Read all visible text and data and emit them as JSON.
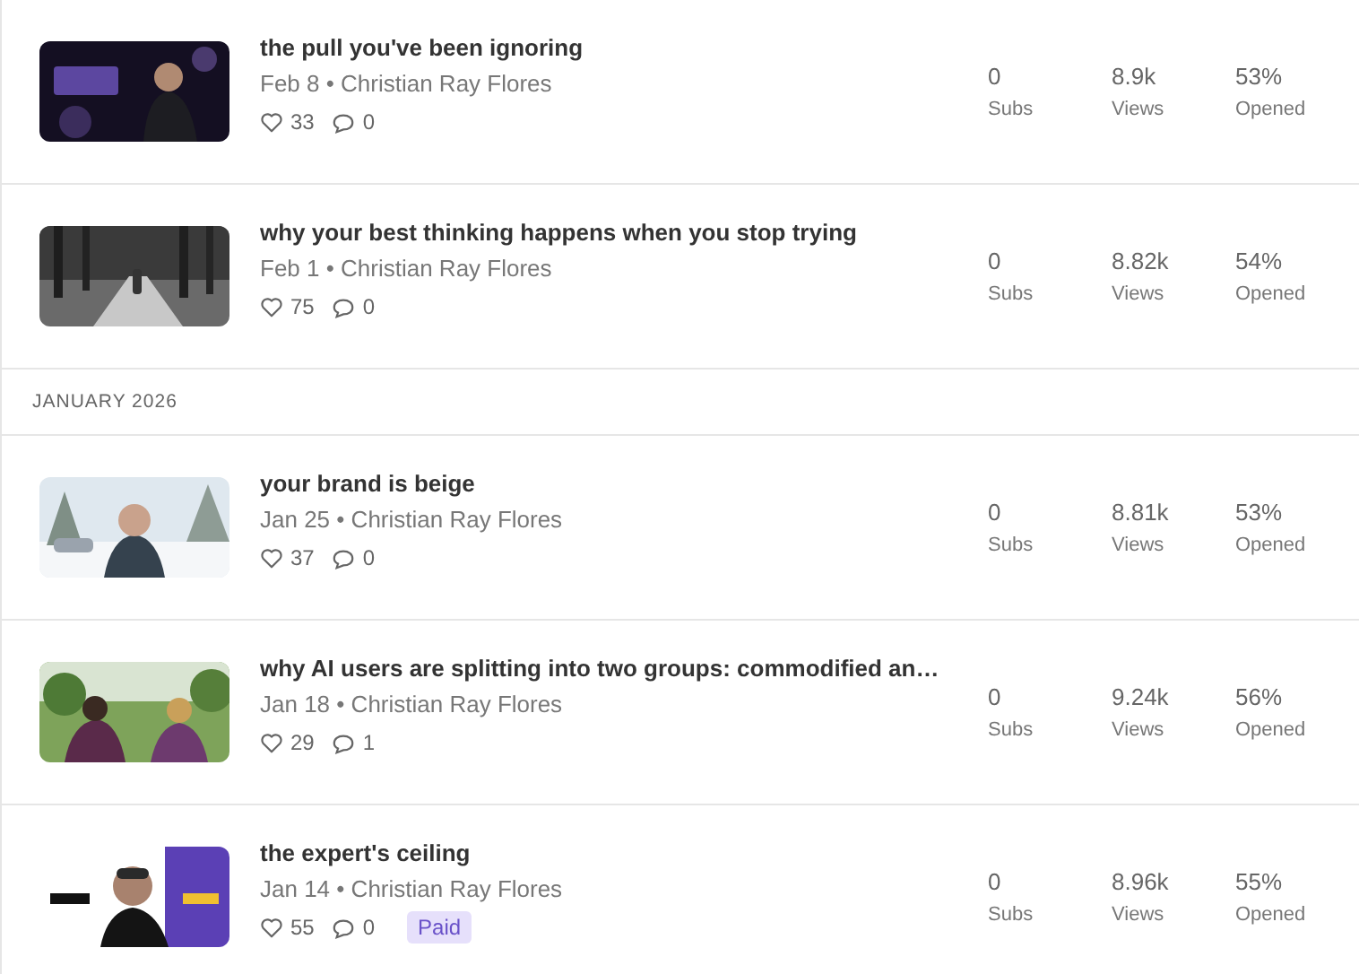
{
  "sections": [
    {
      "posts": [
        {
          "title": "the pull you've been ignoring",
          "byline": "Feb 8 • Christian Ray Flores",
          "likes": "33",
          "comments": "0",
          "stats": [
            {
              "value": "0",
              "label": "Subs"
            },
            {
              "value": "8.9k",
              "label": "Views"
            },
            {
              "value": "53%",
              "label": "Opened"
            }
          ]
        },
        {
          "title": "why your best thinking happens when you stop trying",
          "byline": "Feb 1 • Christian Ray Flores",
          "likes": "75",
          "comments": "0",
          "stats": [
            {
              "value": "0",
              "label": "Subs"
            },
            {
              "value": "8.82k",
              "label": "Views"
            },
            {
              "value": "54%",
              "label": "Opened"
            }
          ]
        }
      ]
    },
    {
      "heading": "JANUARY 2026",
      "posts": [
        {
          "title": "your brand is beige",
          "byline": "Jan 25 • Christian Ray Flores",
          "likes": "37",
          "comments": "0",
          "stats": [
            {
              "value": "0",
              "label": "Subs"
            },
            {
              "value": "8.81k",
              "label": "Views"
            },
            {
              "value": "53%",
              "label": "Opened"
            }
          ]
        },
        {
          "title": "why AI users are splitting into two groups: commodified an…",
          "byline": "Jan 18 • Christian Ray Flores",
          "likes": "29",
          "comments": "1",
          "stats": [
            {
              "value": "0",
              "label": "Subs"
            },
            {
              "value": "9.24k",
              "label": "Views"
            },
            {
              "value": "56%",
              "label": "Opened"
            }
          ]
        },
        {
          "title": "the expert's ceiling",
          "byline": "Jan 14 • Christian Ray Flores",
          "likes": "55",
          "comments": "0",
          "badge": "Paid",
          "stats": [
            {
              "value": "0",
              "label": "Subs"
            },
            {
              "value": "8.96k",
              "label": "Views"
            },
            {
              "value": "55%",
              "label": "Opened"
            }
          ]
        }
      ]
    }
  ]
}
